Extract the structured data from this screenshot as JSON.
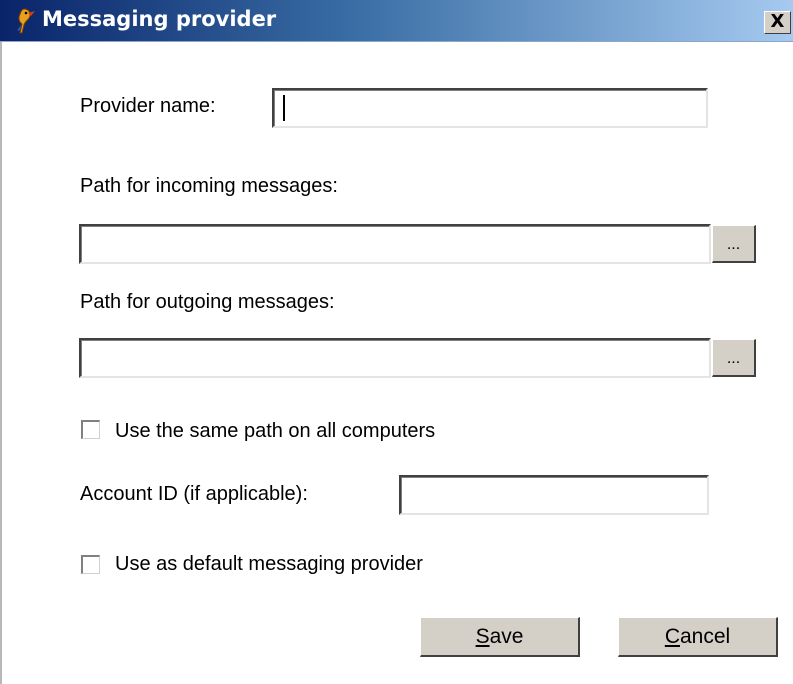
{
  "window": {
    "title": "Messaging provider",
    "close_label": "X"
  },
  "form": {
    "provider_name_label": "Provider name:",
    "provider_name_value": "",
    "incoming_path_label": "Path for incoming messages:",
    "incoming_path_value": "",
    "outgoing_path_label": "Path for outgoing messages:",
    "outgoing_path_value": "",
    "browse_label": "...",
    "same_path_label": "Use the same path on all computers",
    "same_path_checked": false,
    "account_id_label": "Account ID (if applicable):",
    "account_id_value": "",
    "default_provider_label": "Use as default messaging provider",
    "default_provider_checked": false
  },
  "buttons": {
    "save_mnemonic": "S",
    "save_rest": "ave",
    "cancel_mnemonic": "C",
    "cancel_rest": "ancel"
  },
  "icons": {
    "title_icon": "bird-icon",
    "close_icon": "close-icon"
  },
  "colors": {
    "titlebar_start": "#0a246a",
    "titlebar_end": "#a6caf0",
    "button_face": "#d4d0c8"
  }
}
